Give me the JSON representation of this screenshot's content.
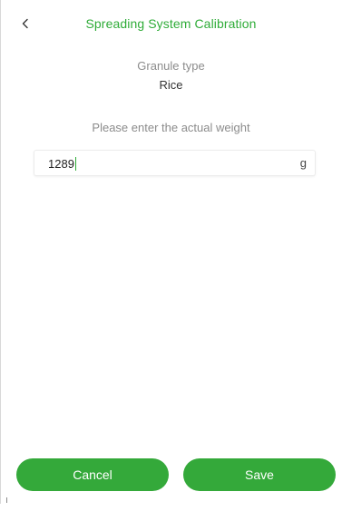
{
  "header": {
    "back_icon": "chevron-left-icon",
    "title": "Spreading System Calibration"
  },
  "granule": {
    "label": "Granule type",
    "value": "Rice"
  },
  "weight": {
    "prompt": "Please enter the actual weight",
    "value": "1289",
    "unit": "g"
  },
  "actions": {
    "cancel_label": "Cancel",
    "save_label": "Save"
  },
  "colors": {
    "accent": "#2fac38",
    "button_bg": "#34a93a",
    "button_text": "#ffffff",
    "muted_text": "#8c8c8c"
  }
}
